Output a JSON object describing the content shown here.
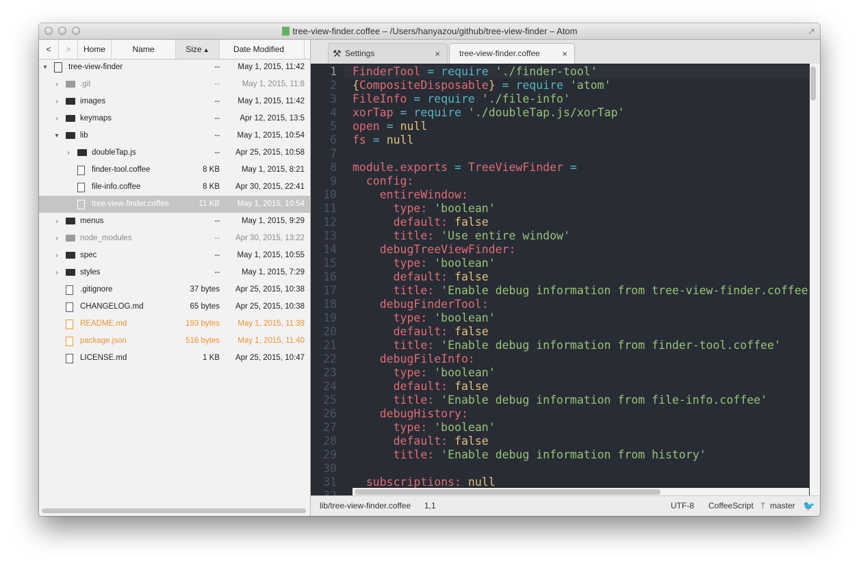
{
  "window": {
    "title": "tree-view-finder.coffee – /Users/hanyazou/github/tree-view-finder – Atom",
    "fullscreen_icon": "↗"
  },
  "finder": {
    "toolbar": {
      "back": "<",
      "forward": ">",
      "home": "Home",
      "name": "Name",
      "size": "Size",
      "size_sort_icon": "▲",
      "date": "Date Modified"
    },
    "rows": [
      {
        "name": "tree-view-finder",
        "size": "--",
        "date": "May 1, 2015, 11:42",
        "type": "repo",
        "arrow": "▾",
        "depth": 0
      },
      {
        "name": ".git",
        "size": "--",
        "date": "May 1, 2015, 11:8",
        "type": "folder",
        "arrow": "›",
        "depth": 1,
        "state": "dim"
      },
      {
        "name": "images",
        "size": "--",
        "date": "May 1, 2015, 11:42",
        "type": "folder",
        "arrow": "›",
        "depth": 1
      },
      {
        "name": "keymaps",
        "size": "--",
        "date": "Apr 12, 2015, 13:5",
        "type": "folder",
        "arrow": "›",
        "depth": 1
      },
      {
        "name": "lib",
        "size": "--",
        "date": "May 1, 2015, 10:54",
        "type": "folder",
        "arrow": "▾",
        "depth": 1
      },
      {
        "name": "doubleTap.js",
        "size": "--",
        "date": "Apr 25, 2015, 10:58",
        "type": "folder",
        "arrow": "›",
        "depth": 2
      },
      {
        "name": "finder-tool.coffee",
        "size": "8 KB",
        "date": "May 1, 2015, 8:21",
        "type": "doc",
        "arrow": "",
        "depth": 2
      },
      {
        "name": "file-info.coffee",
        "size": "8 KB",
        "date": "Apr 30, 2015, 22:41",
        "type": "doc",
        "arrow": "",
        "depth": 2
      },
      {
        "name": "tree-view-finder.coffee",
        "size": "11 KB",
        "date": "May 1, 2015, 10:54",
        "type": "doc",
        "arrow": "",
        "depth": 2,
        "state": "selected"
      },
      {
        "name": "menus",
        "size": "--",
        "date": "May 1, 2015, 9:29",
        "type": "folder",
        "arrow": "›",
        "depth": 1
      },
      {
        "name": "node_modules",
        "size": "--",
        "date": "Apr 30, 2015, 13:22",
        "type": "folder",
        "arrow": "›",
        "depth": 1,
        "state": "dim"
      },
      {
        "name": "spec",
        "size": "--",
        "date": "May 1, 2015, 10:55",
        "type": "folder",
        "arrow": "›",
        "depth": 1
      },
      {
        "name": "styles",
        "size": "--",
        "date": "May 1, 2015, 7:29",
        "type": "folder",
        "arrow": "›",
        "depth": 1
      },
      {
        "name": ".gitignore",
        "size": "37 bytes",
        "date": "Apr 25, 2015, 10:38",
        "type": "doc",
        "arrow": "",
        "depth": 1
      },
      {
        "name": "CHANGELOG.md",
        "size": "65 bytes",
        "date": "Apr 25, 2015, 10:38",
        "type": "doc",
        "arrow": "",
        "depth": 1
      },
      {
        "name": "README.md",
        "size": "193 bytes",
        "date": "May 1, 2015, 11:39",
        "type": "doc",
        "arrow": "",
        "depth": 1,
        "state": "mod"
      },
      {
        "name": "package.json",
        "size": "516 bytes",
        "date": "May 1, 2015, 11:40",
        "type": "doc",
        "arrow": "",
        "depth": 1,
        "state": "mod"
      },
      {
        "name": "LICENSE.md",
        "size": "1 KB",
        "date": "Apr 25, 2015, 10:47",
        "type": "doc",
        "arrow": "",
        "depth": 1
      }
    ]
  },
  "tabs": [
    {
      "label": "Settings",
      "icon": "⚒",
      "close": "×"
    },
    {
      "label": "tree-view-finder.coffee",
      "close": "×"
    }
  ],
  "editor": {
    "lines": [
      [
        [
          "t-var",
          "FinderTool"
        ],
        [
          "t-op",
          " = "
        ],
        [
          "t-kw",
          "require"
        ],
        [
          "t-str",
          " './finder-tool'"
        ]
      ],
      [
        [
          "t-brace",
          "{"
        ],
        [
          "t-var",
          "CompositeDisposable"
        ],
        [
          "t-brace",
          "}"
        ],
        [
          "t-op",
          " = "
        ],
        [
          "t-kw",
          "require"
        ],
        [
          "t-str",
          " 'atom'"
        ]
      ],
      [
        [
          "t-var",
          "FileInfo"
        ],
        [
          "t-op",
          " = "
        ],
        [
          "t-kw",
          "require"
        ],
        [
          "t-str",
          " './file-info'"
        ]
      ],
      [
        [
          "t-var",
          "xorTap"
        ],
        [
          "t-op",
          " = "
        ],
        [
          "t-kw",
          "require"
        ],
        [
          "t-str",
          " './doubleTap.js/xorTap'"
        ]
      ],
      [
        [
          "t-var",
          "open"
        ],
        [
          "t-op",
          " = "
        ],
        [
          "t-null",
          "null"
        ]
      ],
      [
        [
          "t-var",
          "fs"
        ],
        [
          "t-op",
          " = "
        ],
        [
          "t-null",
          "null"
        ]
      ],
      [],
      [
        [
          "t-var",
          "module.exports"
        ],
        [
          "t-op",
          " = "
        ],
        [
          "t-var",
          "TreeViewFinder"
        ],
        [
          "t-op",
          " ="
        ]
      ],
      [
        [
          "t-def",
          "  config:"
        ]
      ],
      [
        [
          "t-def",
          "    entireWindow:"
        ]
      ],
      [
        [
          "t-def",
          "      type: "
        ],
        [
          "t-str",
          "'boolean'"
        ]
      ],
      [
        [
          "t-def",
          "      default: "
        ],
        [
          "t-null",
          "false"
        ]
      ],
      [
        [
          "t-def",
          "      title: "
        ],
        [
          "t-str",
          "'Use entire window'"
        ]
      ],
      [
        [
          "t-def",
          "    debugTreeViewFinder:"
        ]
      ],
      [
        [
          "t-def",
          "      type: "
        ],
        [
          "t-str",
          "'boolean'"
        ]
      ],
      [
        [
          "t-def",
          "      default: "
        ],
        [
          "t-null",
          "false"
        ]
      ],
      [
        [
          "t-def",
          "      title: "
        ],
        [
          "t-str",
          "'Enable debug information from tree-view-finder.coffee"
        ]
      ],
      [
        [
          "t-def",
          "    debugFinderTool:"
        ]
      ],
      [
        [
          "t-def",
          "      type: "
        ],
        [
          "t-str",
          "'boolean'"
        ]
      ],
      [
        [
          "t-def",
          "      default: "
        ],
        [
          "t-null",
          "false"
        ]
      ],
      [
        [
          "t-def",
          "      title: "
        ],
        [
          "t-str",
          "'Enable debug information from finder-tool.coffee'"
        ]
      ],
      [
        [
          "t-def",
          "    debugFileInfo:"
        ]
      ],
      [
        [
          "t-def",
          "      type: "
        ],
        [
          "t-str",
          "'boolean'"
        ]
      ],
      [
        [
          "t-def",
          "      default: "
        ],
        [
          "t-null",
          "false"
        ]
      ],
      [
        [
          "t-def",
          "      title: "
        ],
        [
          "t-str",
          "'Enable debug information from file-info.coffee'"
        ]
      ],
      [
        [
          "t-def",
          "    debugHistory:"
        ]
      ],
      [
        [
          "t-def",
          "      type: "
        ],
        [
          "t-str",
          "'boolean'"
        ]
      ],
      [
        [
          "t-def",
          "      default: "
        ],
        [
          "t-null",
          "false"
        ]
      ],
      [
        [
          "t-def",
          "      title: "
        ],
        [
          "t-str",
          "'Enable debug information from history'"
        ]
      ],
      [],
      [
        [
          "t-def",
          "  subscriptions: "
        ],
        [
          "t-null",
          "null"
        ]
      ],
      []
    ],
    "cursor_line": 1
  },
  "statusbar": {
    "path": "lib/tree-view-finder.coffee",
    "position": "1,1",
    "encoding": "UTF-8",
    "grammar": "CoffeeScript",
    "branch_icon": "ᛘ",
    "branch": "master",
    "feedback_icon": "🐦"
  }
}
